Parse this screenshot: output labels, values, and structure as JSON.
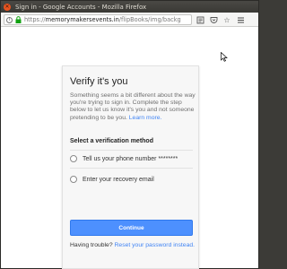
{
  "window": {
    "title": "Sign in - Google Accounts - Mozilla Firefox",
    "close_glyph": "✕"
  },
  "navbar": {
    "url_prefix": "https://",
    "url_host": "memorymakersevents.in",
    "url_path": "/flipBooks/img/backg",
    "icons": [
      "info-icon",
      "lock-icon",
      "reader-view-icon",
      "pocket-icon",
      "bookmark-star-icon",
      "menu-icon"
    ]
  },
  "card": {
    "title": "Verify it's you",
    "description": "Something seems a bit different about the way you're trying to sign in. Complete the step below to let us know it's you and not someone pretending to be you.",
    "learn_more": "Learn more.",
    "method_heading": "Select a verification method",
    "options": [
      {
        "label": "Tell us your phone number ********"
      },
      {
        "label": "Enter your recovery email"
      }
    ],
    "continue_label": "Continue",
    "trouble_text": "Having trouble?",
    "reset_link": "Reset your password",
    "trouble_suffix": "instead."
  },
  "colors": {
    "accent": "#4d90fe",
    "link": "#4285f4",
    "titlebar": "#3c3b37",
    "close_button": "#e95420"
  }
}
